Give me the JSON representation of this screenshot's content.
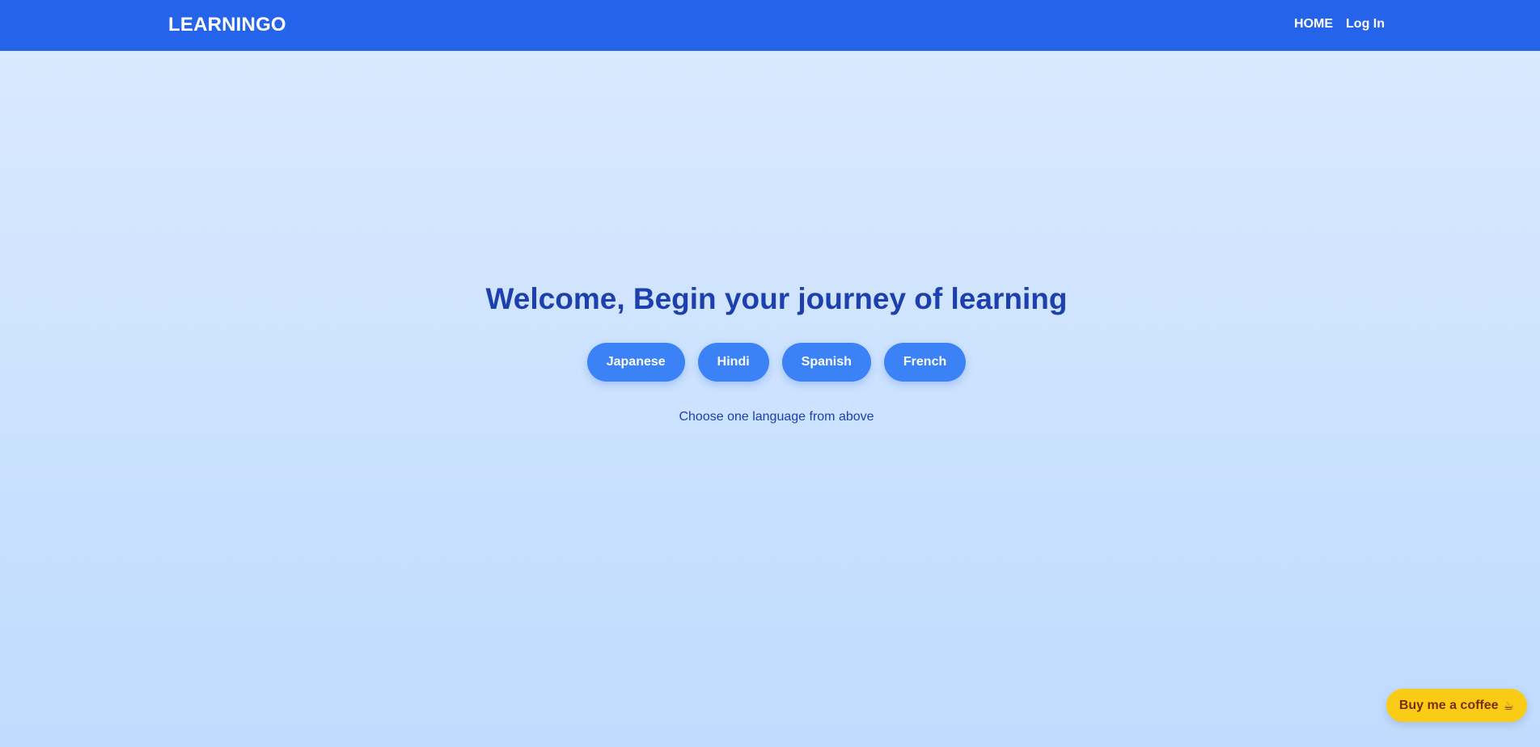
{
  "navbar": {
    "brand": "LEARNINGO",
    "links": [
      {
        "label": "HOME"
      },
      {
        "label": "Log In"
      }
    ],
    "background_color": "#2563eb"
  },
  "hero": {
    "title": "Welcome, Begin your journey of learning",
    "languages": [
      {
        "label": "Japanese"
      },
      {
        "label": "Hindi"
      },
      {
        "label": "Spanish"
      },
      {
        "label": "French"
      }
    ],
    "hint": "Choose one language from above",
    "accent_color": "#3b82f6",
    "text_color": "#1e40af"
  },
  "coffee_button": {
    "label": "Buy me a coffee",
    "icon": "coffee-cup-icon",
    "icon_glyph": "☕",
    "background_color": "#facc15"
  }
}
